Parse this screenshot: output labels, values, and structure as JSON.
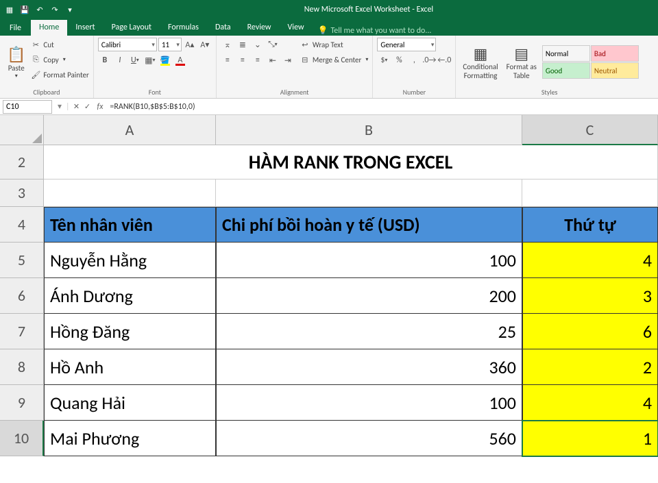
{
  "titlebar": {
    "title": "New Microsoft Excel Worksheet - Excel"
  },
  "tabs": {
    "file": "File",
    "home": "Home",
    "insert": "Insert",
    "pageLayout": "Page Layout",
    "formulas": "Formulas",
    "data": "Data",
    "review": "Review",
    "view": "View",
    "tellme": "Tell me what you want to do..."
  },
  "ribbon": {
    "clipboard": {
      "paste": "Paste",
      "cut": "Cut",
      "copy": "Copy",
      "formatPainter": "Format Painter",
      "label": "Clipboard"
    },
    "font": {
      "name": "Calibri",
      "size": "11",
      "label": "Font"
    },
    "alignment": {
      "wrap": "Wrap Text",
      "merge": "Merge & Center",
      "label": "Alignment"
    },
    "number": {
      "format": "General",
      "label": "Number"
    },
    "styles": {
      "cond": "Conditional\nFormatting",
      "fmtTable": "Format as\nTable",
      "normal": "Normal",
      "bad": "Bad",
      "good": "Good",
      "neutral": "Neutral",
      "label": "Styles"
    }
  },
  "formulaBar": {
    "cellRef": "C10",
    "formula": "=RANK(B10,$B$5:B$10,0)"
  },
  "columns": [
    "A",
    "B",
    "C"
  ],
  "rows": [
    "2",
    "3",
    "4",
    "5",
    "6",
    "7",
    "8",
    "9",
    "10"
  ],
  "sheet": {
    "title": "HÀM RANK TRONG EXCEL",
    "headers": {
      "a": "Tên nhân viên",
      "b": "Chi phí bồi hoàn y tế (USD)",
      "c": "Thứ tự"
    },
    "data": [
      {
        "name": "Nguyễn Hằng",
        "cost": "100",
        "rank": "4"
      },
      {
        "name": "Ánh Dương",
        "cost": "200",
        "rank": "3"
      },
      {
        "name": "Hồng Đăng",
        "cost": "25",
        "rank": "6"
      },
      {
        "name": "Hồ Anh",
        "cost": "360",
        "rank": "2"
      },
      {
        "name": "Quang Hải",
        "cost": "100",
        "rank": "4"
      },
      {
        "name": "Mai Phương",
        "cost": "560",
        "rank": "1"
      }
    ]
  },
  "chart_data": {
    "type": "table",
    "title": "HÀM RANK TRONG EXCEL",
    "columns": [
      "Tên nhân viên",
      "Chi phí bồi hoàn y tế (USD)",
      "Thứ tự"
    ],
    "rows": [
      [
        "Nguyễn Hằng",
        100,
        4
      ],
      [
        "Ánh Dương",
        200,
        3
      ],
      [
        "Hồng Đăng",
        25,
        6
      ],
      [
        "Hồ Anh",
        360,
        2
      ],
      [
        "Quang Hải",
        100,
        4
      ],
      [
        "Mai Phương",
        560,
        1
      ]
    ]
  }
}
